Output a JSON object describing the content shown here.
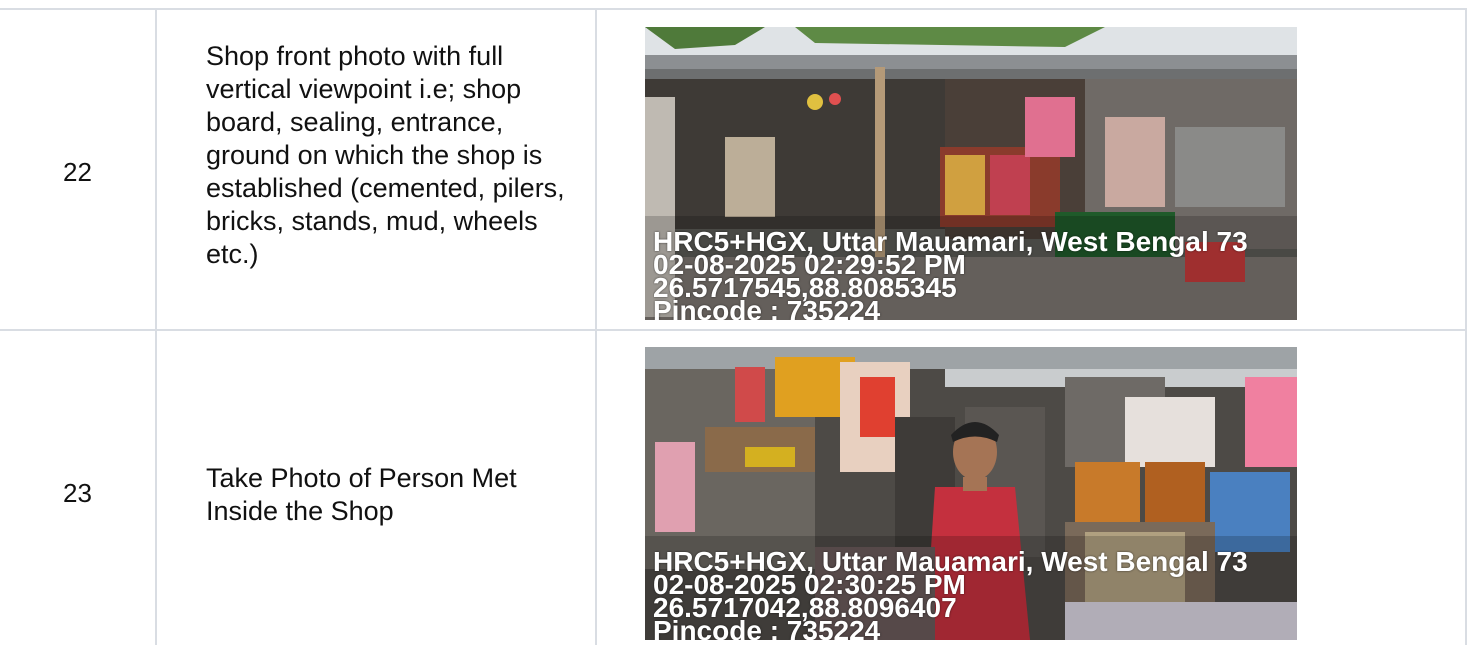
{
  "rows": [
    {
      "number": "22",
      "description": "Shop front photo with full vertical viewpoint i.e; shop board, sealing, entrance, ground on which the shop is established (cemented, pilers, bricks, stands, mud, wheels etc.)",
      "photo": {
        "stamp_line1": "HRC5+HGX, Uttar Mauamari, West Bengal 73",
        "stamp_line2": "02-08-2025 02:29:52 PM",
        "stamp_line3": "26.5717545,88.8085345",
        "stamp_line4": "Pincode : 735224"
      }
    },
    {
      "number": "23",
      "description": "Take Photo of Person Met Inside the Shop",
      "photo": {
        "stamp_line1": "HRC5+HGX, Uttar Mauamari, West Bengal 73",
        "stamp_line2": "02-08-2025 02:30:25 PM",
        "stamp_line3": "26.5717042,88.8096407",
        "stamp_line4": "Pincode : 735224"
      }
    }
  ]
}
